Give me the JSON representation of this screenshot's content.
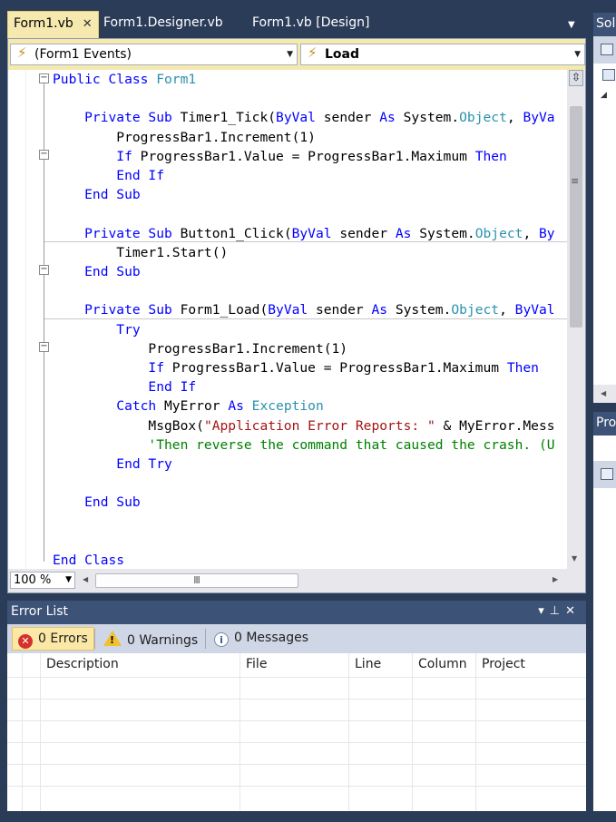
{
  "tabs": [
    {
      "label": "Form1.vb",
      "active": true,
      "close": "✕"
    },
    {
      "label": "Form1.Designer.vb",
      "active": false
    },
    {
      "label": "Form1.vb [Design]",
      "active": false
    }
  ],
  "navbar": {
    "left_combo": "(Form1 Events)",
    "right_combo": "Load"
  },
  "code_lines": [
    [
      [
        "kw",
        "Public Class "
      ],
      [
        "ty",
        "Form1"
      ]
    ],
    [],
    [
      [
        "kw",
        "    Private Sub "
      ],
      [
        "tx",
        "Timer1_Tick("
      ],
      [
        "kw",
        "ByVal "
      ],
      [
        "tx",
        "sender "
      ],
      [
        "kw",
        "As "
      ],
      [
        "tx",
        "System."
      ],
      [
        "ty",
        "Object"
      ],
      [
        "tx",
        ", "
      ],
      [
        "kw",
        "ByVa"
      ]
    ],
    [
      [
        "tx",
        "        ProgressBar1.Increment(1)"
      ]
    ],
    [
      [
        "kw",
        "        If "
      ],
      [
        "tx",
        "ProgressBar1.Value = ProgressBar1.Maximum "
      ],
      [
        "kw",
        "Then"
      ]
    ],
    [
      [
        "kw",
        "        End If"
      ]
    ],
    [
      [
        "kw",
        "    End Sub"
      ]
    ],
    [],
    [
      [
        "kw",
        "    Private Sub "
      ],
      [
        "tx",
        "Button1_Click("
      ],
      [
        "kw",
        "ByVal "
      ],
      [
        "tx",
        "sender "
      ],
      [
        "kw",
        "As "
      ],
      [
        "tx",
        "System."
      ],
      [
        "ty",
        "Object"
      ],
      [
        "tx",
        ", "
      ],
      [
        "kw",
        "By"
      ]
    ],
    [
      [
        "tx",
        "        Timer1.Start()"
      ]
    ],
    [
      [
        "kw",
        "    End Sub"
      ]
    ],
    [],
    [
      [
        "kw",
        "    Private Sub "
      ],
      [
        "tx",
        "Form1_Load("
      ],
      [
        "kw",
        "ByVal "
      ],
      [
        "tx",
        "sender "
      ],
      [
        "kw",
        "As "
      ],
      [
        "tx",
        "System."
      ],
      [
        "ty",
        "Object"
      ],
      [
        "tx",
        ", "
      ],
      [
        "kw",
        "ByVal"
      ]
    ],
    [
      [
        "kw",
        "        Try"
      ]
    ],
    [
      [
        "tx",
        "            ProgressBar1.Increment(1)"
      ]
    ],
    [
      [
        "kw",
        "            If "
      ],
      [
        "tx",
        "ProgressBar1.Value = ProgressBar1.Maximum "
      ],
      [
        "kw",
        "Then"
      ]
    ],
    [
      [
        "kw",
        "            End If"
      ]
    ],
    [
      [
        "kw",
        "        Catch "
      ],
      [
        "tx",
        "MyError "
      ],
      [
        "kw",
        "As "
      ],
      [
        "ty",
        "Exception"
      ]
    ],
    [
      [
        "tx",
        "            MsgBox("
      ],
      [
        "st",
        "\"Application Error Reports: \""
      ],
      [
        "tx",
        " & MyError.Mess"
      ]
    ],
    [
      [
        "cm",
        "            'Then reverse the command that caused the crash. (U"
      ]
    ],
    [
      [
        "kw",
        "        End Try"
      ]
    ],
    [],
    [
      [
        "kw",
        "    End Sub"
      ]
    ],
    [],
    [],
    [
      [
        "kw",
        "End Class"
      ]
    ]
  ],
  "editor": {
    "zoom": "100 %"
  },
  "error_list": {
    "title": "Error List",
    "errors": "0 Errors",
    "warnings": "0 Warnings",
    "messages": "0 Messages",
    "columns": [
      "Description",
      "File",
      "Line",
      "Column",
      "Project"
    ]
  },
  "side_panels": {
    "solution_title": "Solu",
    "properties_title": "Pro"
  },
  "icons": {
    "close": "close-icon",
    "bolt": "lightning-bolt-icon",
    "error": "error-icon",
    "warning": "warning-icon",
    "info": "info-icon"
  }
}
